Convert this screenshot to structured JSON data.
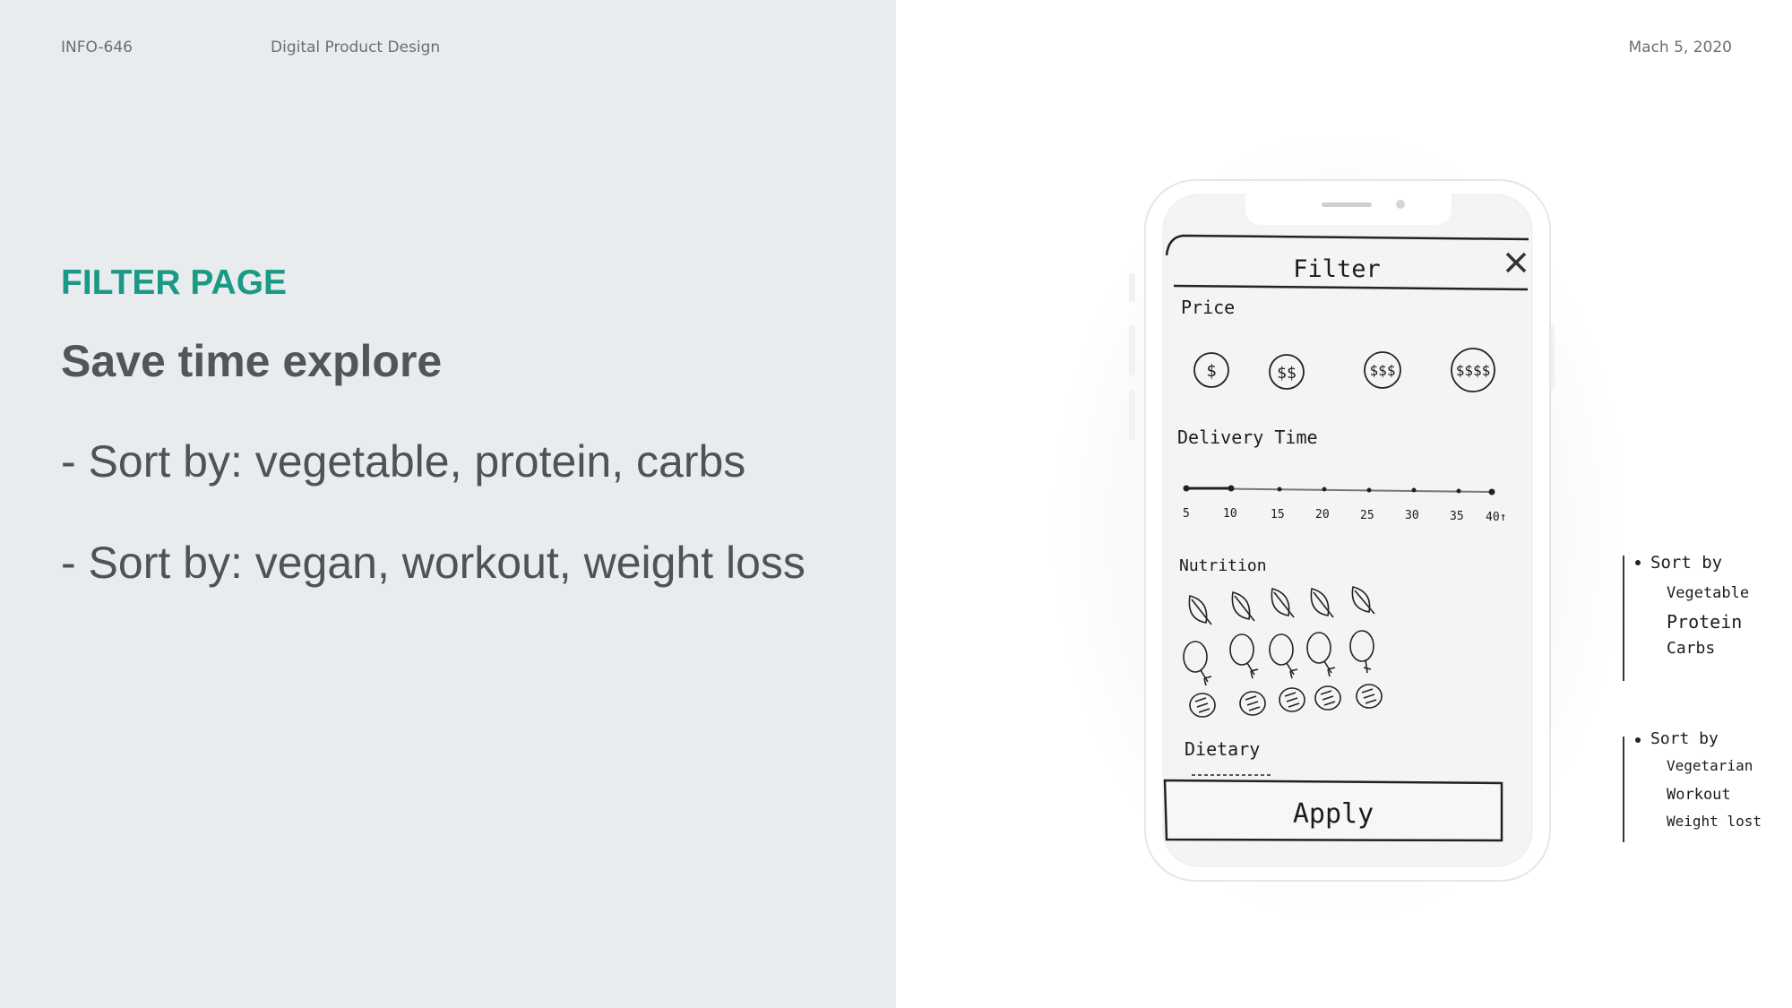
{
  "header": {
    "course_code": "INFO-646",
    "course_name": "Digital Product Design",
    "date": "Mach 5, 2020"
  },
  "slide": {
    "section_label": "FILTER PAGE",
    "headline": "Save time explore",
    "bullets": [
      "- Sort by: vegetable, protein, carbs",
      "- Sort by: vegan, workout, weight loss"
    ]
  },
  "sketch": {
    "title": "Filter",
    "price_label": "Price",
    "price_options": [
      "$",
      "$$",
      "$$$",
      "$$$$"
    ],
    "delivery_label": "Delivery Time",
    "delivery_ticks": [
      "5",
      "10",
      "15",
      "20",
      "25",
      "30",
      "35",
      "40↑"
    ],
    "nutrition_label": "Nutrition",
    "dietary_label": "Dietary",
    "apply_label": "Apply",
    "close_icon": "close-icon",
    "nutrition_icons": [
      "leaf-icon",
      "drumstick-icon",
      "bread-icon"
    ]
  },
  "notes": {
    "group_1": [
      "Sort by",
      "Vegetable",
      "Protein",
      "Carbs"
    ],
    "group_2": [
      "Sort by",
      "Vegetarian",
      "Workout",
      "Weight lost"
    ]
  },
  "colors": {
    "accent": "#1a9a86",
    "left_panel": "#e9ecee",
    "text_dark": "#535557"
  }
}
